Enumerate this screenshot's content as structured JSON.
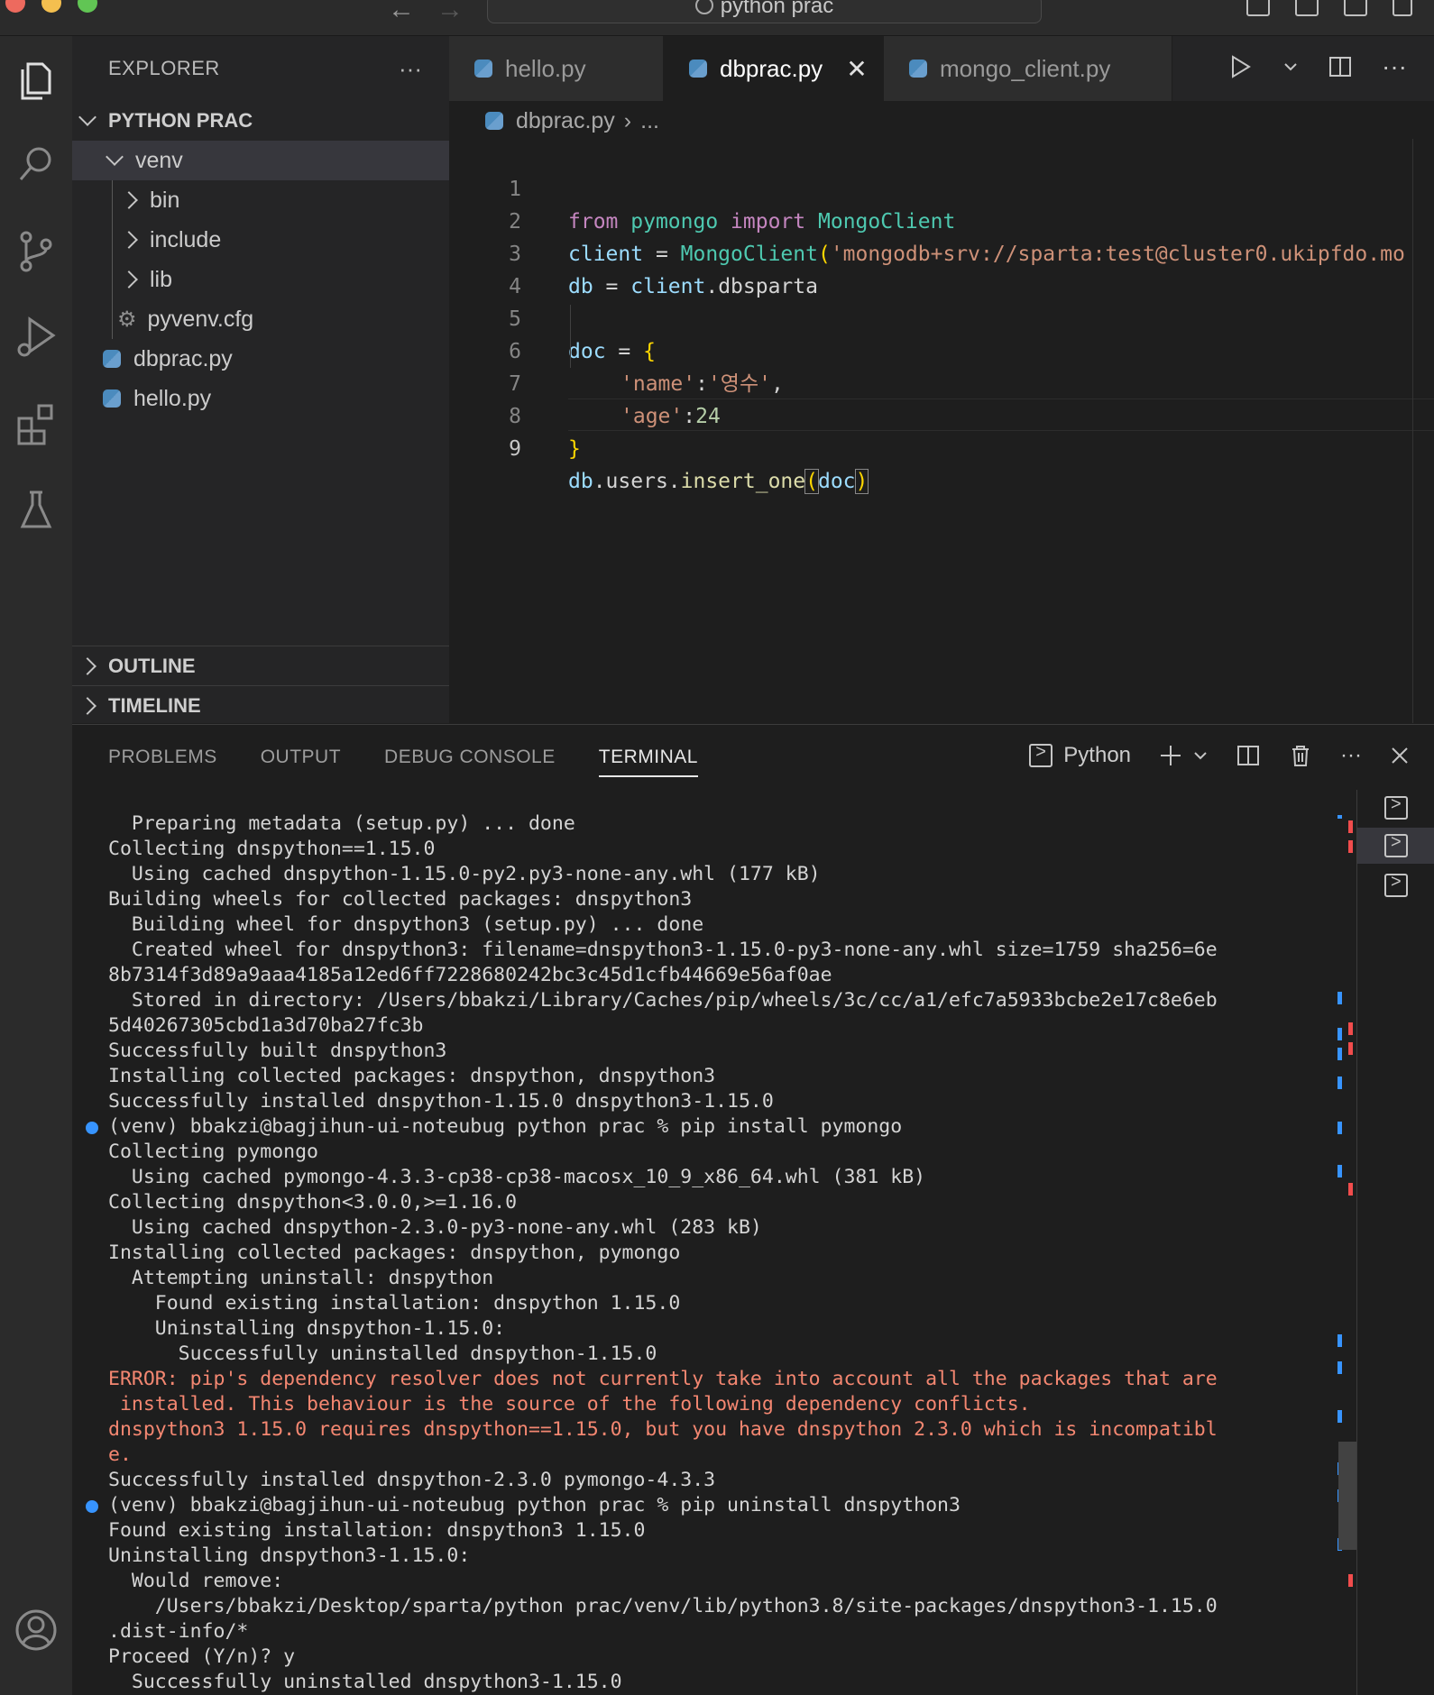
{
  "window": {
    "search_text": "python prac"
  },
  "sidebar": {
    "title": "EXPLORER",
    "more": "···",
    "project": "PYTHON PRAC",
    "tree": [
      {
        "label": "venv",
        "type": "folder-open",
        "depth": 1
      },
      {
        "label": "bin",
        "type": "folder",
        "depth": 2
      },
      {
        "label": "include",
        "type": "folder",
        "depth": 2
      },
      {
        "label": "lib",
        "type": "folder",
        "depth": 2
      },
      {
        "label": "pyvenv.cfg",
        "type": "gear-file",
        "depth": 2
      },
      {
        "label": "dbprac.py",
        "type": "python",
        "depth": 1
      },
      {
        "label": "hello.py",
        "type": "python",
        "depth": 1
      }
    ],
    "outline": "OUTLINE",
    "timeline": "TIMELINE"
  },
  "tabs": [
    {
      "label": "hello.py",
      "active": false
    },
    {
      "label": "dbprac.py",
      "active": true
    },
    {
      "label": "mongo_client.py",
      "active": false
    }
  ],
  "breadcrumb": {
    "file": "dbprac.py",
    "rest": "..."
  },
  "code": {
    "line_numbers": [
      "1",
      "2",
      "3",
      "4",
      "5",
      "6",
      "7",
      "8",
      "9"
    ],
    "l1": {
      "kw1": "from",
      "mod": "pymongo",
      "kw2": "import",
      "cls": "MongoClient"
    },
    "l2": {
      "var": "client",
      "op": " = ",
      "cls": "MongoClient",
      "paren": "(",
      "str": "'mongodb+srv://sparta:test@cluster0.ukipfdo.mo"
    },
    "l3": {
      "var": "db",
      "op": " = ",
      "var2": "client",
      "rest": ".dbsparta"
    },
    "l5": {
      "var": "doc",
      "op": " = ",
      "brace": "{"
    },
    "l6": {
      "key": "'name'",
      "colon": ":",
      "val": "'영수'",
      "comma": ","
    },
    "l7": {
      "key": "'age'",
      "colon": ":",
      "val": "24"
    },
    "l8": {
      "brace": "}"
    },
    "l9": {
      "obj": "db",
      "mid": ".users.",
      "fn": "insert_one",
      "open": "(",
      "arg": "doc",
      "close": ")"
    }
  },
  "panel": {
    "tabs": [
      "PROBLEMS",
      "OUTPUT",
      "DEBUG CONSOLE",
      "TERMINAL"
    ],
    "shell_label": "Python"
  },
  "terminal": {
    "lines": [
      "  Preparing metadata (setup.py) ... done",
      "Collecting dnspython==1.15.0",
      "  Using cached dnspython-1.15.0-py2.py3-none-any.whl (177 kB)",
      "Building wheels for collected packages: dnspython3",
      "  Building wheel for dnspython3 (setup.py) ... done",
      "  Created wheel for dnspython3: filename=dnspython3-1.15.0-py3-none-any.whl size=1759 sha256=6e",
      "8b7314f3d89a9aaa4185a12ed6ff7228680242bc3c45d1cfb44669e56af0ae",
      "  Stored in directory: /Users/bbakzi/Library/Caches/pip/wheels/3c/cc/a1/efc7a5933bcbe2e17c8e6eb",
      "5d40267305cbd1a3d70ba27fc3b",
      "Successfully built dnspython3",
      "Installing collected packages: dnspython, dnspython3",
      "Successfully installed dnspython-1.15.0 dnspython3-1.15.0",
      "(venv) bbakzi@bagjihun-ui-noteubug python prac % pip install pymongo",
      "Collecting pymongo",
      "  Using cached pymongo-4.3.3-cp38-cp38-macosx_10_9_x86_64.whl (381 kB)",
      "Collecting dnspython<3.0.0,>=1.16.0",
      "  Using cached dnspython-2.3.0-py3-none-any.whl (283 kB)",
      "Installing collected packages: dnspython, pymongo",
      "  Attempting uninstall: dnspython",
      "    Found existing installation: dnspython 1.15.0",
      "    Uninstalling dnspython-1.15.0:",
      "      Successfully uninstalled dnspython-1.15.0",
      "ERROR: pip's dependency resolver does not currently take into account all the packages that are",
      " installed. This behaviour is the source of the following dependency conflicts.",
      "dnspython3 1.15.0 requires dnspython==1.15.0, but you have dnspython 2.3.0 which is incompatibl",
      "e.",
      "Successfully installed dnspython-2.3.0 pymongo-4.3.3",
      "(venv) bbakzi@bagjihun-ui-noteubug python prac % pip uninstall dnspython3",
      "Found existing installation: dnspython3 1.15.0",
      "Uninstalling dnspython3-1.15.0:",
      "  Would remove:",
      "    /Users/bbakzi/Desktop/sparta/python prac/venv/lib/python3.8/site-packages/dnspython3-1.15.0",
      ".dist-info/*",
      "Proceed (Y/n)? y",
      "  Successfully uninstalled dnspython3-1.15.0"
    ]
  },
  "colors": {
    "accent": "#3794ff",
    "error": "#f48771",
    "background": "#1e1e1e"
  }
}
